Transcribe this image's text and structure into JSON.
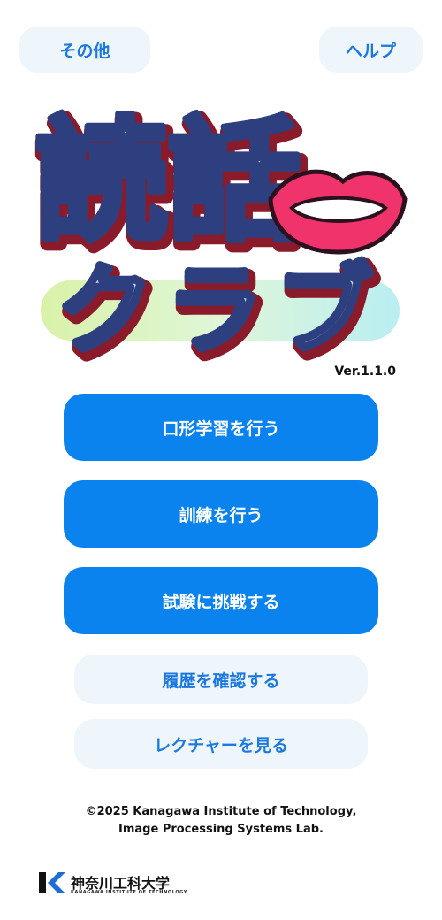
{
  "header": {
    "other_label": "その他",
    "help_label": "ヘルプ"
  },
  "logo": {
    "title_top": "読話",
    "title_bottom": "クラブ"
  },
  "version": "Ver.1.1.0",
  "menu": {
    "study_label": "口形学習を行う",
    "train_label": "訓練を行う",
    "exam_label": "試験に挑戦する",
    "history_label": "履歴を確認する",
    "lecture_label": "レクチャーを見る"
  },
  "footer": {
    "copyright_line1": "©2025 Kanagawa Institute of Technology,",
    "copyright_line2": "Image Processing Systems Lab.",
    "university_name": "神奈川工科大学",
    "university_name_en": "KANAGAWA INSTITUTE OF TECHNOLOGY"
  },
  "colors": {
    "primary": "#0b83ef",
    "secondary_bg": "#eef5fb",
    "secondary_text": "#1a78e0",
    "logo_fill": "#7f9fe0",
    "logo_outline": "#2d3f7f",
    "lips": "#f0336b"
  }
}
